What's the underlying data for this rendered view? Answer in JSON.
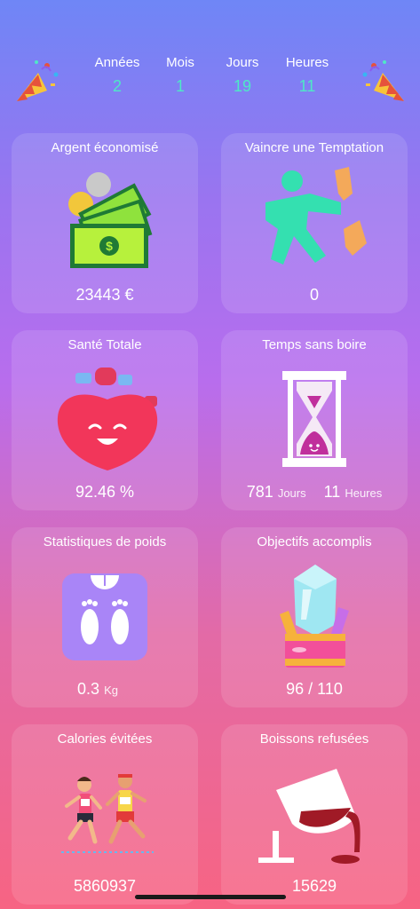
{
  "counters": [
    {
      "label": "Années",
      "value": "2"
    },
    {
      "label": "Mois",
      "value": "1"
    },
    {
      "label": "Jours",
      "value": "19"
    },
    {
      "label": "Heures",
      "value": "11"
    }
  ],
  "cards": {
    "money": {
      "title": "Argent économisé",
      "value": "23443 €"
    },
    "temptation": {
      "title": "Vaincre une Temptation",
      "value": "0"
    },
    "health": {
      "title": "Santé Totale",
      "value": "92.46 %"
    },
    "time": {
      "title": "Temps sans boire",
      "days": "781",
      "days_unit": "Jours",
      "hours": "11",
      "hours_unit": "Heures"
    },
    "weight": {
      "title": "Statistiques de poids",
      "value": "0.3",
      "unit": "Kg"
    },
    "goals": {
      "title": "Objectifs accomplis",
      "value": "96 / 110"
    },
    "calories": {
      "title": "Calories évitées",
      "value": "5860937"
    },
    "drinks": {
      "title": "Boissons refusées",
      "value": "15629"
    }
  },
  "colors": {
    "accent": "#4ee8c6",
    "card_bg": "rgba(255,255,255,0.12)"
  }
}
